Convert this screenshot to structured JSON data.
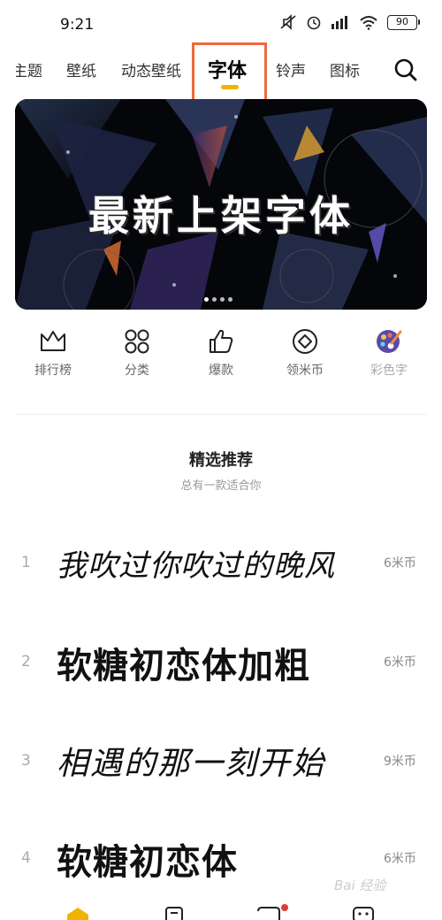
{
  "status_bar": {
    "time": "9:21",
    "battery": "90"
  },
  "tabs": [
    {
      "label": "主题"
    },
    {
      "label": "壁纸"
    },
    {
      "label": "动态壁纸"
    },
    {
      "label": "字体"
    },
    {
      "label": "铃声"
    },
    {
      "label": "图标"
    }
  ],
  "banner": {
    "title": "最新上架字体"
  },
  "quick_menu": [
    {
      "label": "排行榜",
      "icon": "crown-icon"
    },
    {
      "label": "分类",
      "icon": "grid-icon"
    },
    {
      "label": "爆款",
      "icon": "thumbs-up-icon"
    },
    {
      "label": "领米币",
      "icon": "coin-icon"
    },
    {
      "label": "彩色字",
      "icon": "palette-icon"
    }
  ],
  "section": {
    "title": "精选推荐",
    "subtitle": "总有一款适合你"
  },
  "fonts": [
    {
      "rank": "1",
      "name": "我吹过你吹过的晚风",
      "price": "6米币"
    },
    {
      "rank": "2",
      "name": "软糖初恋体加粗",
      "price": "6米币"
    },
    {
      "rank": "3",
      "name": "相遇的那一刻开始",
      "price": "9米币"
    },
    {
      "rank": "4",
      "name": "软糖初恋体",
      "price": "6米币"
    }
  ],
  "watermark": "Bai 经验",
  "colors": {
    "accent": "#f0b400",
    "highlight": "#ec6a3c"
  }
}
